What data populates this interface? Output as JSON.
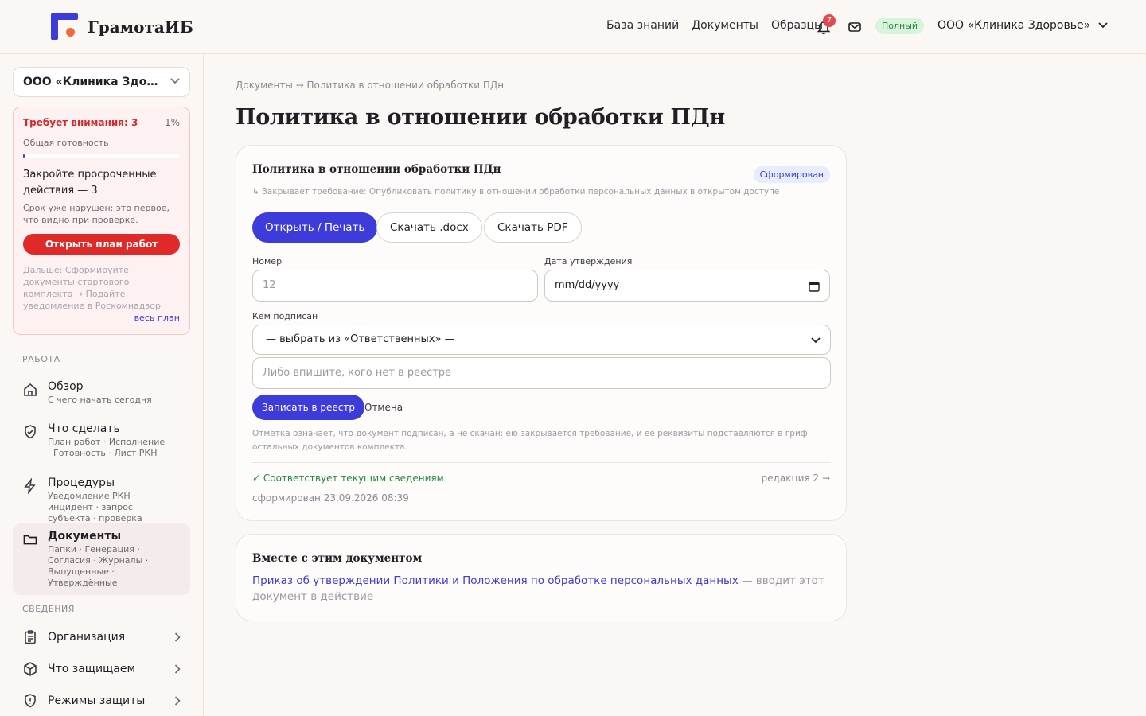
{
  "brand": {
    "name": "ГрамотаИБ"
  },
  "topnav": {
    "items": [
      "База знаний",
      "Документы",
      "Образцы"
    ]
  },
  "header": {
    "notifications_count": "7",
    "plan": "Полный",
    "org": "ООО «Клиника Здоровье»"
  },
  "sidebar": {
    "org_select": "ООО «Клиника Здоровье»",
    "attention": {
      "title": "Требует внимания: 3",
      "percent": "1%",
      "readiness_label": "Общая готовность",
      "readiness_fraction": 0.01,
      "heading": "Закройте просроченные действия — 3",
      "desc": "Срок уже нарушен: это первое, что видно при проверке.",
      "button": "Открыть план работ",
      "next": "Дальше: Сформируйте документы стартового комплекта → Подайте уведомление в Роскомнадзор",
      "all_link": "весь план"
    },
    "section_work": "РАБОТА",
    "work_items": [
      {
        "title": "Обзор",
        "sub": "С чего начать сегодня",
        "icon": "home-icon"
      },
      {
        "title": "Что сделать",
        "sub": "План работ · Исполнение · Готовность · Лист РКН",
        "icon": "shield-check-icon"
      },
      {
        "title": "Процедуры",
        "sub": "Уведомление РКН · инцидент · запрос субъекта · проверка",
        "icon": "lightning-icon"
      },
      {
        "title": "Документы",
        "sub": "Папки · Генерация · Согласия · Журналы · Выпущенные · Утверждённые",
        "icon": "folder-icon"
      }
    ],
    "section_info": "СВЕДЕНИЯ",
    "info_items": [
      {
        "title": "Организация",
        "icon": "clipboard-icon"
      },
      {
        "title": "Что защищаем",
        "icon": "box-icon"
      },
      {
        "title": "Режимы защиты",
        "icon": "shield-alert-icon"
      }
    ]
  },
  "main": {
    "breadcrumb": "Документы → Политика в отношении обработки ПДн",
    "title": "Политика в отношении обработки ПДн",
    "card": {
      "title": "Политика в отношении обработки ПДн",
      "status": "Сформирован",
      "closes": "↳ Закрывает требование: Опубликовать политику в отношении обработки персональных данных в открытом доступе",
      "btn_open": "Открыть / Печать",
      "btn_docx": "Скачать .docx",
      "btn_pdf": "Скачать PDF",
      "number_label": "Номер",
      "number_placeholder": "12",
      "date_label": "Дата утверждения",
      "date_placeholder": "mm/dd/yyyy",
      "signed_label": "Кем подписан",
      "signed_select": "— выбрать из «Ответственных» —",
      "signed_input_placeholder": "Либо впишите, кого нет в реестре",
      "btn_save": "Записать в реестр",
      "btn_cancel": "Отмена",
      "note": "Отметка означает, что документ подписан, а не скачан: ею закрывается требование, и её реквизиты подставляются в гриф остальных документов комплекта.",
      "ok": "✓ Соответствует текущим сведениям",
      "revision": "редакция 2 →",
      "generated": "сформирован 23.09.2026 08:39"
    },
    "related": {
      "title": "Вместе с этим документом",
      "link": "Приказ об утверждении Политики и Положения по обработке персональных данных",
      "suffix": " — вводит этот документ в действие"
    }
  }
}
